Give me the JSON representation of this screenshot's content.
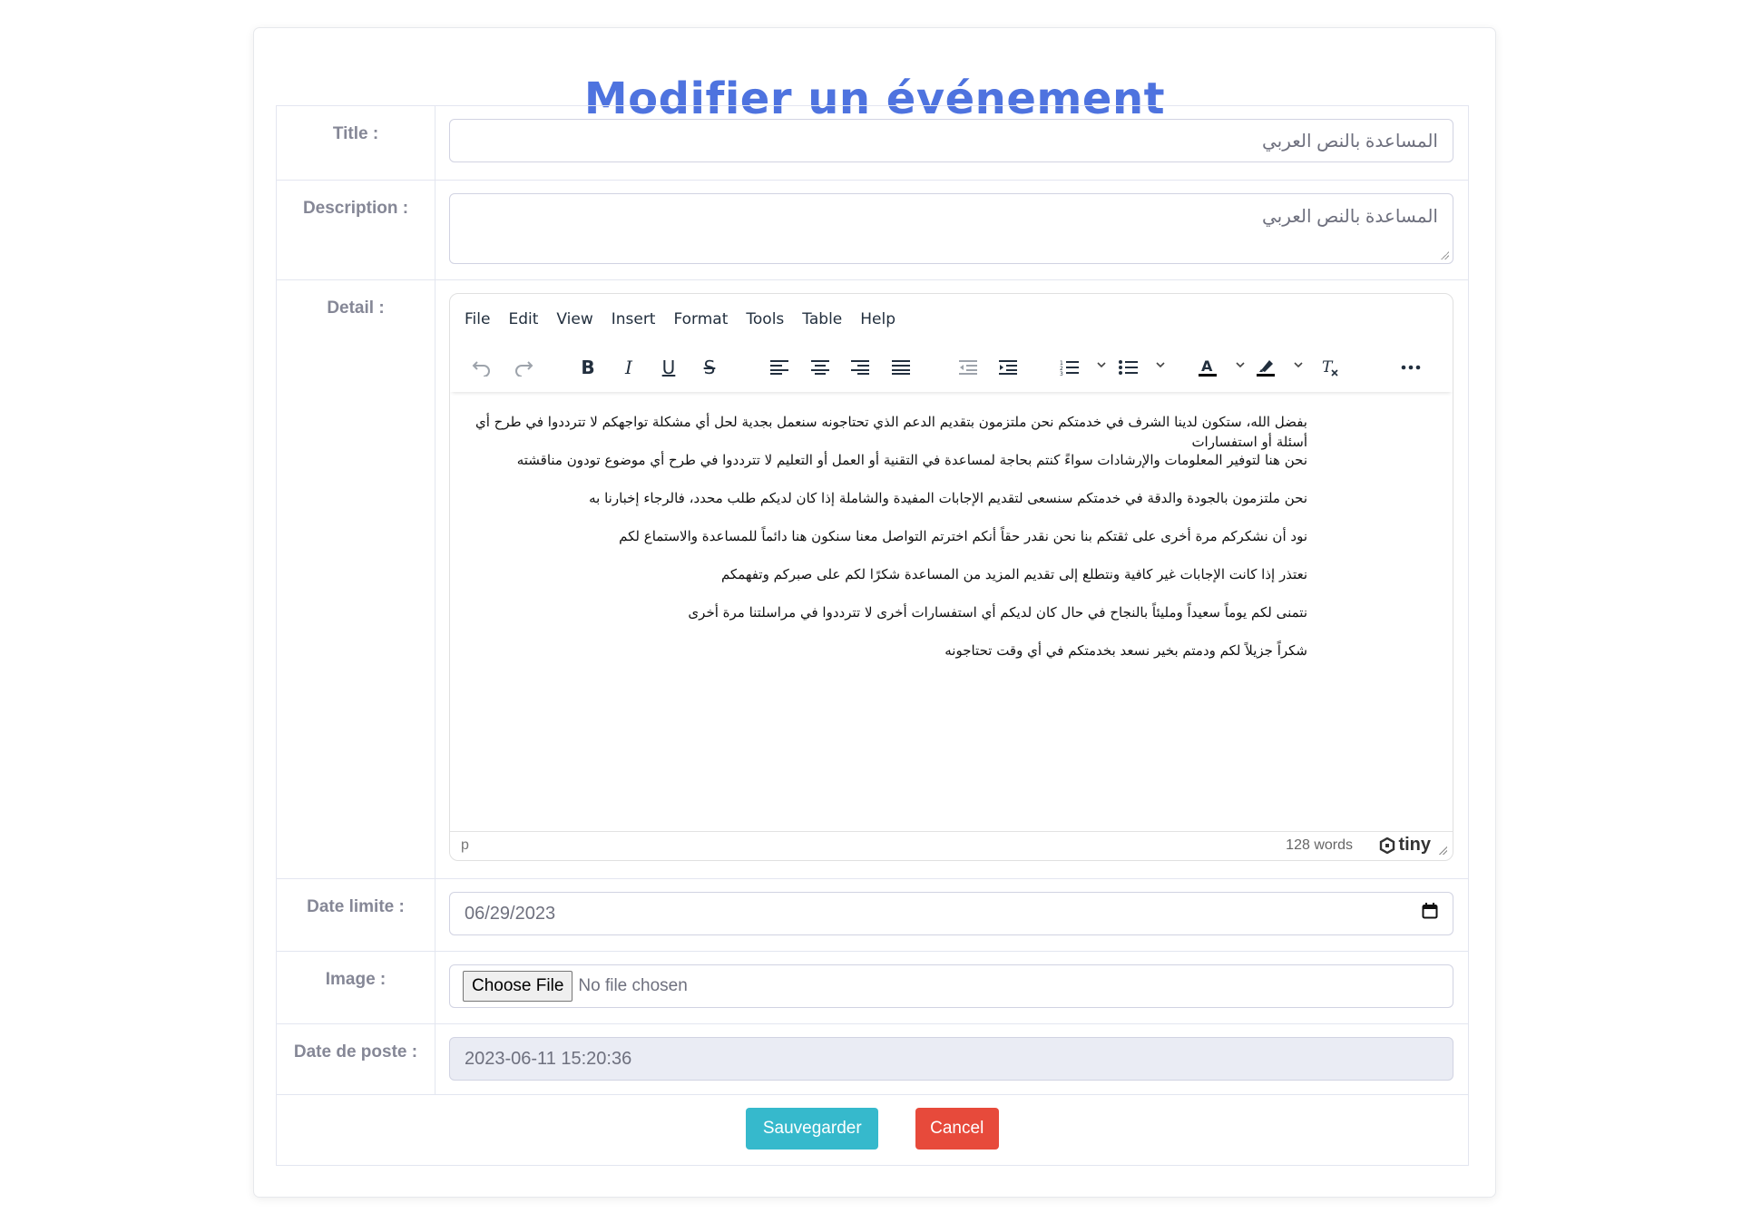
{
  "page": {
    "title": "Modifier un événement"
  },
  "form": {
    "title": {
      "label": "Title :",
      "value": "المساعدة بالنص العربي"
    },
    "description": {
      "label": "Description :",
      "value": "المساعدة بالنص العربي"
    },
    "detail": {
      "label": "Detail :",
      "menu": [
        "File",
        "Edit",
        "View",
        "Insert",
        "Format",
        "Tools",
        "Table",
        "Help"
      ],
      "toolbar_icons": [
        "undo-icon",
        "redo-icon",
        "bold-icon",
        "italic-icon",
        "underline-icon",
        "strikethrough-icon",
        "align-left-icon",
        "align-center-icon",
        "align-right-icon",
        "align-justify-icon",
        "outdent-icon",
        "indent-icon",
        "numbered-list-icon",
        "bullet-list-icon",
        "text-color-icon",
        "highlight-icon",
        "clear-format-icon",
        "more-icon"
      ],
      "paragraphs": [
        "بفضل الله، ستكون لدينا الشرف في خدمتكم نحن ملتزمون بتقديم الدعم الذي تحتاجونه سنعمل بجدية لحل أي مشكلة تواجهكم لا تترددوا في طرح أي أسئلة أو استفسارات",
        "نحن هنا لتوفير المعلومات والإرشادات سواءً كنتم بحاجة لمساعدة في التقنية أو العمل أو التعليم لا تترددوا في طرح أي موضوع تودون مناقشته",
        "نحن ملتزمون بالجودة والدقة في خدمتكم سنسعى لتقديم الإجابات المفيدة والشاملة إذا كان لديكم طلب محدد، فالرجاء إخبارنا به",
        "نود أن نشكركم مرة أخرى على ثقتكم بنا نحن نقدر حقاً أنكم اخترتم التواصل معنا سنكون هنا دائماً للمساعدة والاستماع لكم",
        "نعتذر إذا كانت الإجابات غير كافية ونتطلع إلى تقديم المزيد من المساعدة شكرًا لكم على صبركم وتفهمكم",
        "نتمنى لكم يوماً سعيداً ومليئاً بالنجاح في حال كان لديكم أي استفسارات أخرى لا تترددوا في مراسلتنا مرة أخرى",
        "شكراً جزيلاً لكم ودمتم بخير نسعد بخدمتكم في أي وقت تحتاجونه"
      ],
      "status_path": "p",
      "word_count": "128 words",
      "brand": "tiny"
    },
    "date_limite": {
      "label": "Date limite :",
      "value": "06/29/2023"
    },
    "image": {
      "label": "Image :",
      "button": "Choose File",
      "status": "No file chosen"
    },
    "date_poste": {
      "label": "Date de poste :",
      "value": "2023-06-11 15:20:36"
    }
  },
  "actions": {
    "save": "Sauvegarder",
    "cancel": "Cancel"
  },
  "colors": {
    "title": "#4e73df",
    "save": "#36b9cc",
    "cancel": "#e74a3b",
    "label": "#858796"
  }
}
